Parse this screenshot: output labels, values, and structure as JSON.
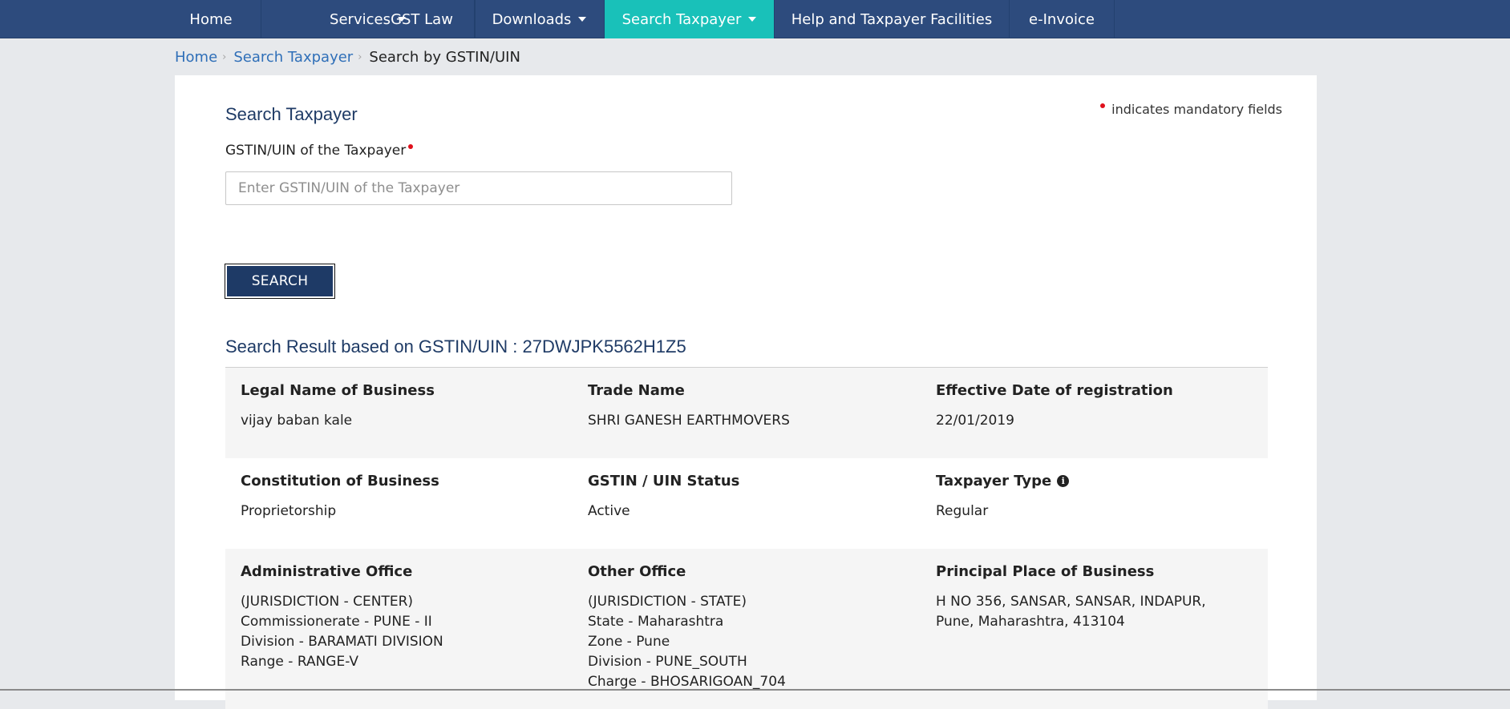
{
  "nav": {
    "items": [
      {
        "label": "Home",
        "dropdown": false,
        "active": false
      },
      {
        "label": "Services",
        "dropdown": true,
        "active": false
      },
      {
        "label": "GST Law",
        "dropdown": false,
        "active": false
      },
      {
        "label": "Downloads",
        "dropdown": true,
        "active": false
      },
      {
        "label": "Search Taxpayer",
        "dropdown": true,
        "active": true
      },
      {
        "label": "Help and Taxpayer Facilities",
        "dropdown": false,
        "active": false
      },
      {
        "label": "e-Invoice",
        "dropdown": false,
        "active": false
      }
    ]
  },
  "breadcrumb": {
    "home": "Home",
    "search_taxpayer": "Search Taxpayer",
    "current": "Search by GSTIN/UIN"
  },
  "form": {
    "mandatory_note": "indicates mandatory fields",
    "title": "Search Taxpayer",
    "gstin_label": "GSTIN/UIN of the Taxpayer",
    "gstin_value": "",
    "gstin_placeholder": "Enter GSTIN/UIN of the Taxpayer",
    "search_button": "SEARCH"
  },
  "result": {
    "title": "Search Result based on GSTIN/UIN : 27DWJPK5562H1Z5",
    "row1": {
      "legal_name_label": "Legal Name of Business",
      "legal_name": "vijay baban kale",
      "trade_name_label": "Trade Name",
      "trade_name": "SHRI GANESH EARTHMOVERS",
      "effective_date_label": "Effective Date of registration",
      "effective_date": "22/01/2019"
    },
    "row2": {
      "constitution_label": "Constitution of Business",
      "constitution": "Proprietorship",
      "status_label": "GSTIN / UIN Status",
      "status": "Active",
      "taxpayer_type_label": "Taxpayer Type",
      "taxpayer_type": "Regular"
    },
    "row3": {
      "admin_office_label": "Administrative Office",
      "admin_office_lines": [
        "(JURISDICTION - CENTER)",
        "Commissionerate - PUNE - II",
        "Division - BARAMATI DIVISION",
        "Range - RANGE-V"
      ],
      "other_office_label": "Other Office",
      "other_office_lines": [
        "(JURISDICTION - STATE)",
        "State - Maharashtra",
        "Zone - Pune",
        "Division - PUNE_SOUTH",
        "Charge - BHOSARIGOAN_704"
      ],
      "principal_place_label": "Principal Place of Business",
      "principal_place_lines": [
        "H NO 356, SANSAR, SANSAR, INDAPUR,",
        "Pune, Maharashtra, 413104"
      ]
    }
  },
  "colors": {
    "nav_bg": "#2d4b7d",
    "nav_active": "#19c1b9",
    "button_bg": "#1e3a66",
    "mandatory_dot": "#e0101b",
    "link": "#2f6fb8"
  },
  "icons": {
    "dropdown": "caret-down-icon",
    "info": "info-circle-icon",
    "breadcrumb_sep": "chevron-right-icon"
  }
}
